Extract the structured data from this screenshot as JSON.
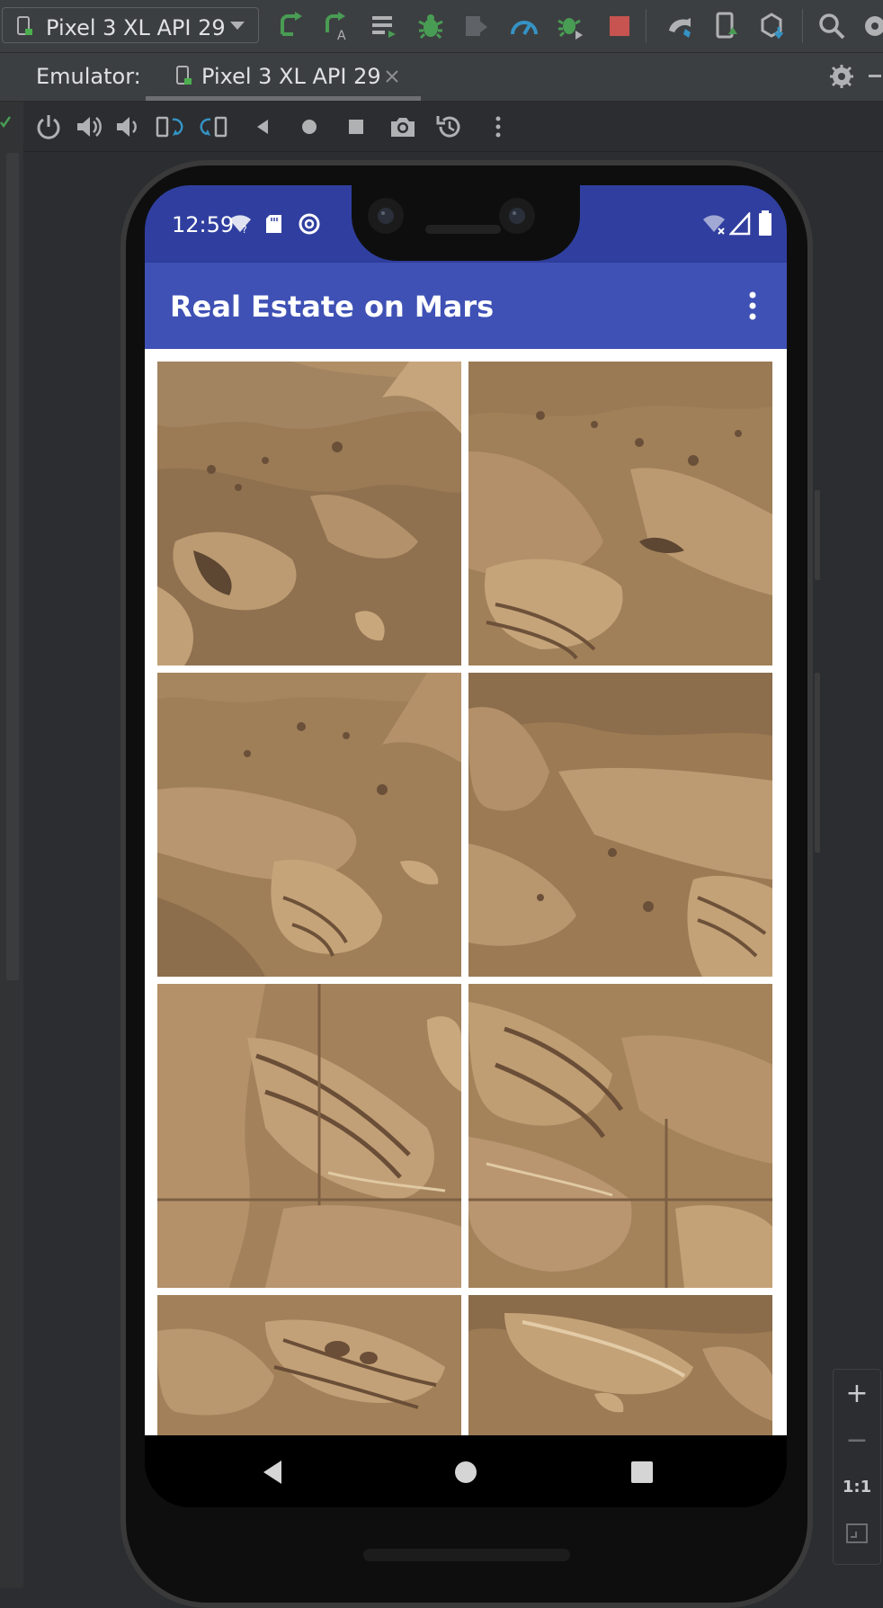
{
  "toolbar": {
    "device_selector_label": "Pixel 3 XL API 29",
    "icons": [
      "device-phone-icon",
      "chevron-down-icon",
      "rerun-icon",
      "apply-code-changes-icon",
      "build-icon",
      "debug-icon",
      "coverage-icon",
      "profile-icon",
      "attach-debugger-icon",
      "stop-icon",
      "sync-gradle-icon",
      "avd-manager-icon",
      "sdk-manager-icon",
      "search-icon",
      "settings-icon"
    ]
  },
  "emulator_tabs": {
    "label": "Emulator:",
    "active_tab": "Pixel 3 XL API 29"
  },
  "emulator_controls": [
    "power-icon",
    "volume-up-icon",
    "volume-down-icon",
    "rotate-left-icon",
    "rotate-right-icon",
    "back-icon",
    "home-icon",
    "overview-icon",
    "screenshot-icon",
    "snapshot-icon",
    "more-icon"
  ],
  "device": {
    "status": {
      "time": "12:59",
      "accent": "#303f9f"
    },
    "app": {
      "title": "Real Estate on Mars",
      "primary_color": "#3f51b5"
    },
    "grid": {
      "columns": 2,
      "photos": [
        {
          "name": "mars-photo-1"
        },
        {
          "name": "mars-photo-2"
        },
        {
          "name": "mars-photo-3"
        },
        {
          "name": "mars-photo-4"
        },
        {
          "name": "mars-photo-5"
        },
        {
          "name": "mars-photo-6"
        },
        {
          "name": "mars-photo-7"
        },
        {
          "name": "mars-photo-8"
        }
      ]
    },
    "nav": [
      "back-icon",
      "home-icon",
      "recents-icon"
    ]
  },
  "zoom_panel": {
    "zoom_in": "+",
    "zoom_out": "−",
    "actual_size": "1:1"
  }
}
